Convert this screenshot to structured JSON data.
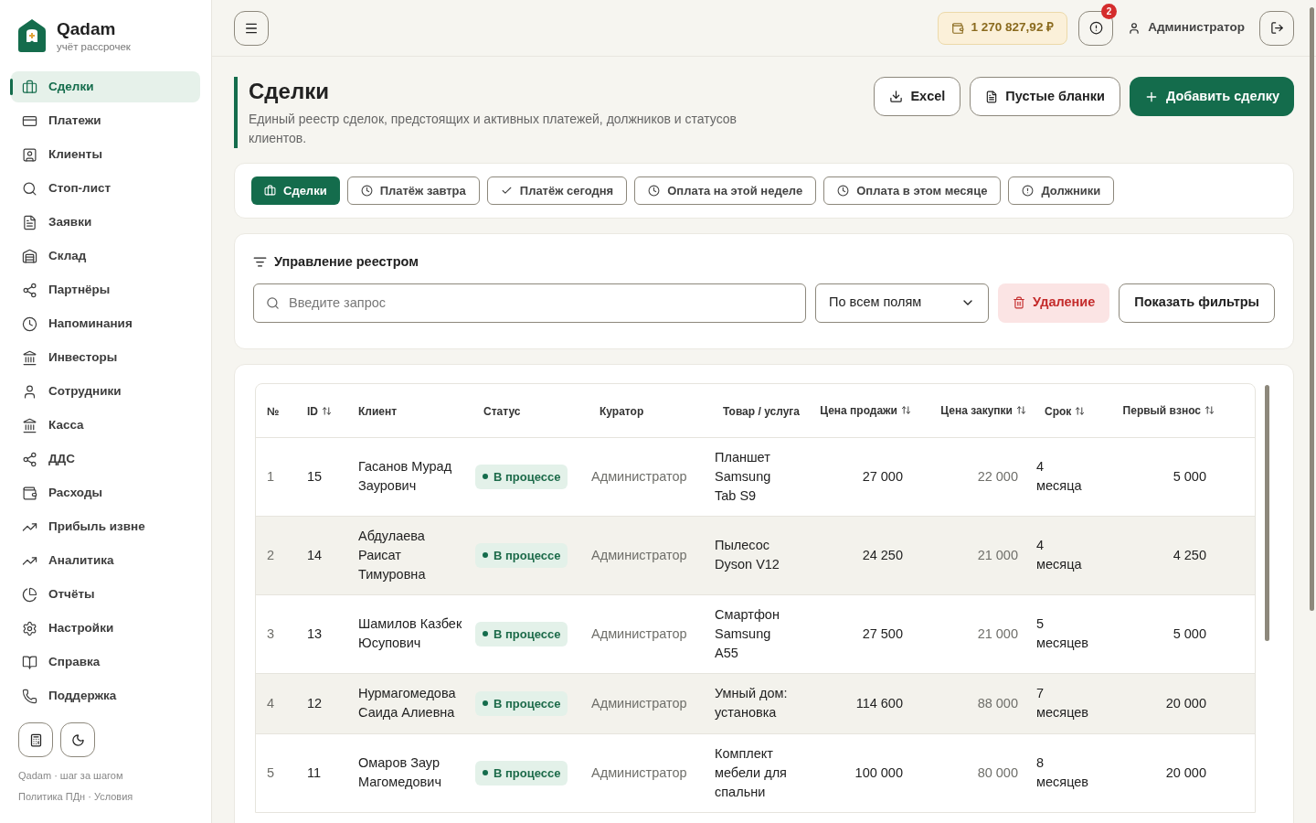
{
  "brand": {
    "name": "Qadam",
    "tagline": "учёт рассрочек"
  },
  "sidebar": {
    "items": [
      {
        "label": "Сделки",
        "selected": true
      },
      {
        "label": "Платежи",
        "selected": false
      },
      {
        "label": "Клиенты",
        "selected": false
      },
      {
        "label": "Стоп-лист",
        "selected": false
      },
      {
        "label": "Заявки",
        "selected": false
      },
      {
        "label": "Склад",
        "selected": false
      },
      {
        "label": "Партнёры",
        "selected": false
      },
      {
        "label": "Напоминания",
        "selected": false
      },
      {
        "label": "Инвесторы",
        "selected": false
      },
      {
        "label": "Сотрудники",
        "selected": false
      },
      {
        "label": "Касса",
        "selected": false
      },
      {
        "label": "ДДС",
        "selected": false
      },
      {
        "label": "Расходы",
        "selected": false
      },
      {
        "label": "Прибыль извне",
        "selected": false
      },
      {
        "label": "Аналитика",
        "selected": false
      },
      {
        "label": "Отчёты",
        "selected": false
      },
      {
        "label": "Настройки",
        "selected": false
      },
      {
        "label": "Справка",
        "selected": false
      },
      {
        "label": "Поддержка",
        "selected": false
      }
    ],
    "footer": [
      "Qadam · шаг за шагом",
      "Политика ПДн · Условия"
    ]
  },
  "topbar": {
    "balance": "1 270 827,92 ₽",
    "notifications": "2",
    "user": "Администратор"
  },
  "page": {
    "title": "Сделки",
    "description": "Единый реестр сделок, предстоящих и активных платежей, должников и статусов клиентов.",
    "actions": [
      "Excel",
      "Пустые бланки",
      "Добавить сделку"
    ]
  },
  "filters": [
    {
      "label": "Сделки",
      "selected": true
    },
    {
      "label": "Платёж завтра",
      "selected": false
    },
    {
      "label": "Платёж сегодня",
      "selected": false
    },
    {
      "label": "Оплата на этой неделе",
      "selected": false
    },
    {
      "label": "Оплата в этом месяце",
      "selected": false
    },
    {
      "label": "Должники",
      "selected": false
    }
  ],
  "registry": {
    "title": "Управление реестром",
    "search": {
      "placeholder": "Введите запрос"
    },
    "scope": "По всем полям",
    "delete": "Удаление",
    "show_filters": "Показать фильтры"
  },
  "table": {
    "columns": [
      {
        "label": "№",
        "sortable": false
      },
      {
        "label": "ID",
        "sortable": true
      },
      {
        "label": "Клиент",
        "sortable": false
      },
      {
        "label": "Статус",
        "sortable": false
      },
      {
        "label": "Куратор",
        "sortable": false
      },
      {
        "label": "Товар / услуга",
        "sortable": false
      },
      {
        "label": "Цена продажи",
        "sortable": true
      },
      {
        "label": "Цена закупки",
        "sortable": true
      },
      {
        "label": "Срок",
        "sortable": true
      },
      {
        "label": "Первый взнос",
        "sortable": true
      }
    ],
    "rows": [
      {
        "no": "1",
        "id": "15",
        "client": "Гасанов Мурад Заурович",
        "status": "В процессе",
        "curator": "Администратор",
        "product": "Планшет Samsung Tab S9",
        "sale": "27 000",
        "purchase": "22 000",
        "term": "4 месяца",
        "deposit": "5 000"
      },
      {
        "no": "2",
        "id": "14",
        "client": "Абдулаева Раисат Тимуровна",
        "status": "В процессе",
        "curator": "Администратор",
        "product": "Пылесос Dyson V12",
        "sale": "24 250",
        "purchase": "21 000",
        "term": "4 месяца",
        "deposit": "4 250"
      },
      {
        "no": "3",
        "id": "13",
        "client": "Шамилов Казбек Юсупович",
        "status": "В процессе",
        "curator": "Администратор",
        "product": "Смартфон Samsung A55",
        "sale": "27 500",
        "purchase": "21 000",
        "term": "5 месяцев",
        "deposit": "5 000"
      },
      {
        "no": "4",
        "id": "12",
        "client": "Нурмагомедова Саида Алиевна",
        "status": "В процессе",
        "curator": "Администратор",
        "product": "Умный дом: установка",
        "sale": "114 600",
        "purchase": "88 000",
        "term": "7 месяцев",
        "deposit": "20 000"
      },
      {
        "no": "5",
        "id": "11",
        "client": "Омаров Заур Магомедович",
        "status": "В процессе",
        "curator": "Администратор",
        "product": "Комплект мебели для спальни",
        "sale": "100 000",
        "purchase": "80 000",
        "term": "8 месяцев",
        "deposit": "20 000"
      }
    ]
  }
}
